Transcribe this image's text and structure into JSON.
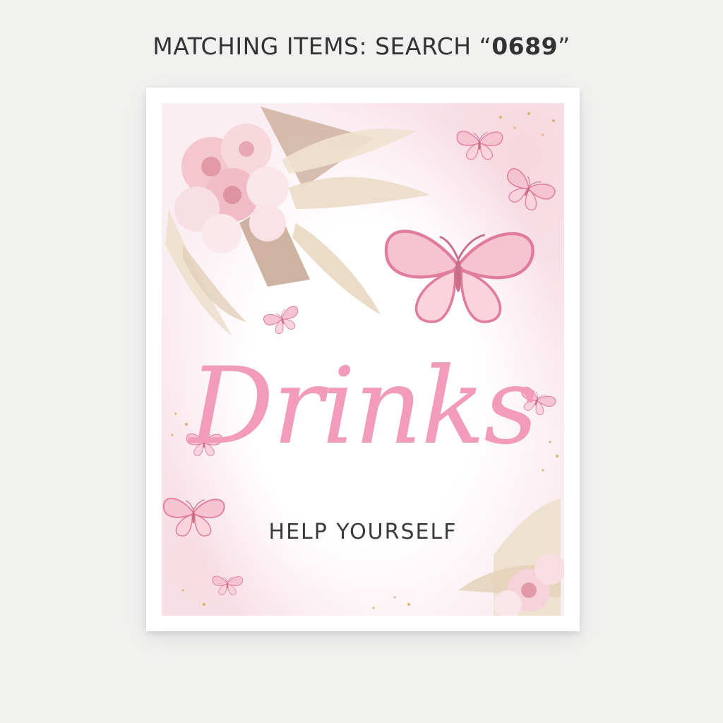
{
  "banner": {
    "prefix": "MATCHING ITEMS: SEARCH “",
    "code": "0689",
    "suffix": "”"
  },
  "poster": {
    "title": "Drinks",
    "subtitle": "HELP YOURSELF"
  },
  "colors": {
    "wall": "#f1f1f0",
    "frame": "#ffffff",
    "title_pink": "#f29bbb",
    "butterfly_pink": "#e98aa6",
    "gold": "#d9b36a"
  }
}
